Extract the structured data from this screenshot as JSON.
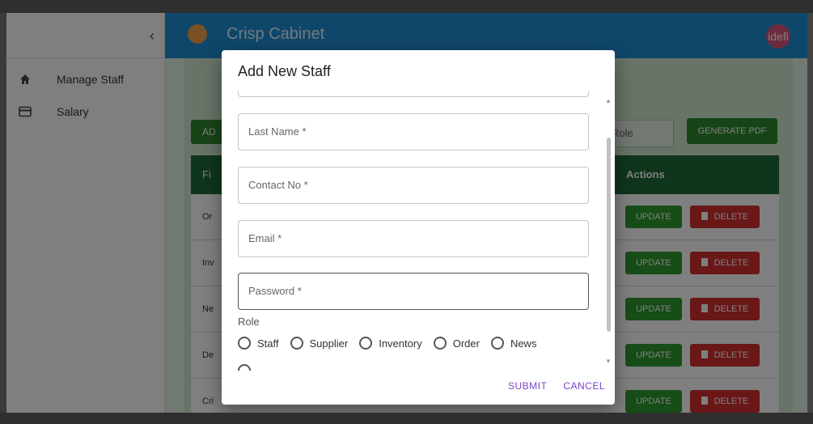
{
  "sidebar": {
    "collapse_icon": "chevron-left-icon",
    "collapse_glyph": "‹",
    "items": [
      {
        "label": "Manage Staff",
        "icon": "home-icon"
      },
      {
        "label": "Salary",
        "icon": "card-icon"
      }
    ]
  },
  "appbar": {
    "title": "Crisp Cabinet",
    "avatar_text": "idefi",
    "color": "#1f8fd6"
  },
  "toolbar": {
    "add_label": "AD",
    "role_value": "Role",
    "pdf_label": "GENERATE PDF"
  },
  "table": {
    "first_header": "Fi",
    "actions_header": "Actions",
    "rows": [
      {
        "first": "Or",
        "update": "UPDATE",
        "delete": "DELETE"
      },
      {
        "first": "Inv",
        "update": "UPDATE",
        "delete": "DELETE"
      },
      {
        "first": "Ne",
        "update": "UPDATE",
        "delete": "DELETE"
      },
      {
        "first": "De",
        "update": "UPDATE",
        "delete": "DELETE"
      },
      {
        "first": "Cri",
        "update": "UPDATE",
        "delete": "DELETE"
      }
    ]
  },
  "dialog": {
    "title": "Add New Staff",
    "fields": {
      "last_name": "Last Name *",
      "contact": "Contact No *",
      "email": "Email *",
      "password": "Password *"
    },
    "role_label": "Role",
    "roles": [
      "Staff",
      "Supplier",
      "Inventory",
      "Order",
      "News"
    ],
    "submit_label": "SUBMIT",
    "cancel_label": "CANCEL",
    "accent": "#7b43c9"
  }
}
